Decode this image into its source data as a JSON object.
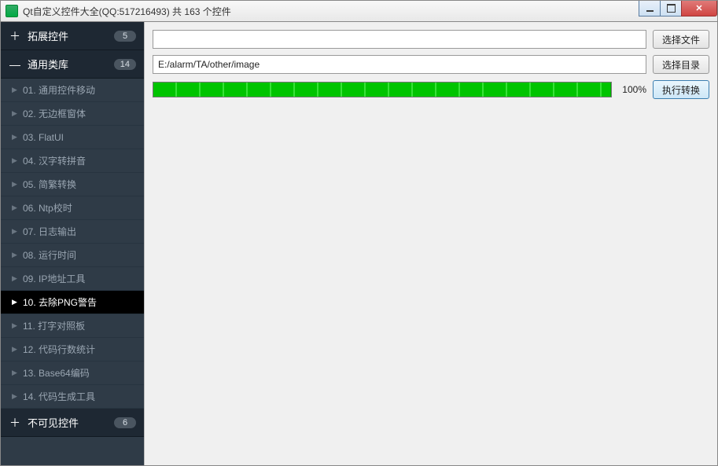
{
  "window": {
    "title": "Qt自定义控件大全(QQ:517216493) 共 163 个控件"
  },
  "sidebar": {
    "groups": [
      {
        "icon": "＋",
        "label": "拓展控件",
        "badge": "5",
        "expanded": false,
        "items": []
      },
      {
        "icon": "—",
        "label": "通用类库",
        "badge": "14",
        "expanded": true,
        "items": [
          {
            "label": "01. 通用控件移动",
            "selected": false
          },
          {
            "label": "02. 无边框窗体",
            "selected": false
          },
          {
            "label": "03. FlatUI",
            "selected": false
          },
          {
            "label": "04. 汉字转拼音",
            "selected": false
          },
          {
            "label": "05. 简繁转换",
            "selected": false
          },
          {
            "label": "06. Ntp校时",
            "selected": false
          },
          {
            "label": "07. 日志输出",
            "selected": false
          },
          {
            "label": "08. 运行时间",
            "selected": false
          },
          {
            "label": "09. IP地址工具",
            "selected": false
          },
          {
            "label": "10. 去除PNG警告",
            "selected": true
          },
          {
            "label": "11. 打字对照板",
            "selected": false
          },
          {
            "label": "12. 代码行数统计",
            "selected": false
          },
          {
            "label": "13. Base64编码",
            "selected": false
          },
          {
            "label": "14. 代码生成工具",
            "selected": false
          }
        ]
      },
      {
        "icon": "＋",
        "label": "不可见控件",
        "badge": "6",
        "expanded": false,
        "items": []
      }
    ]
  },
  "main": {
    "file_input": {
      "value": ""
    },
    "dir_input": {
      "value": "E:/alarm/TA/other/image"
    },
    "buttons": {
      "select_file": "选择文件",
      "select_dir": "选择目录",
      "execute": "执行转换"
    },
    "progress": {
      "percent": 100,
      "label": "100%"
    }
  }
}
